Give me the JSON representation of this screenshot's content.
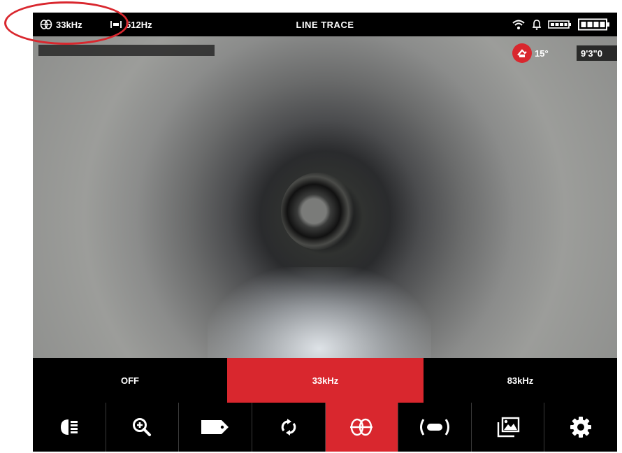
{
  "status_bar": {
    "frequency_primary": "33kHz",
    "frequency_primary_icon": "coil-icon",
    "frequency_secondary": "512Hz",
    "frequency_secondary_icon": "sonde-icon",
    "mode_title": "LINE TRACE",
    "right_icons": [
      "wifi-icon",
      "bell-icon",
      "battery-small-icon",
      "battery-full-icon"
    ]
  },
  "camera_hud": {
    "tilt_value": "15°",
    "tilt_icon": "tilt-icon",
    "distance_value": "9'3\"0"
  },
  "frequency_selector": {
    "options": [
      "OFF",
      "33kHz",
      "83kHz"
    ],
    "selected": "33kHz"
  },
  "toolbar": {
    "buttons": [
      {
        "name": "light-icon"
      },
      {
        "name": "zoom-in-icon"
      },
      {
        "name": "tag-icon"
      },
      {
        "name": "rotate-icon"
      },
      {
        "name": "line-trace-icon",
        "active": true
      },
      {
        "name": "sonde-icon"
      },
      {
        "name": "gallery-icon"
      },
      {
        "name": "settings-icon"
      }
    ]
  },
  "colors": {
    "accent": "#d9272e",
    "background": "#000000",
    "text": "#ffffff"
  }
}
